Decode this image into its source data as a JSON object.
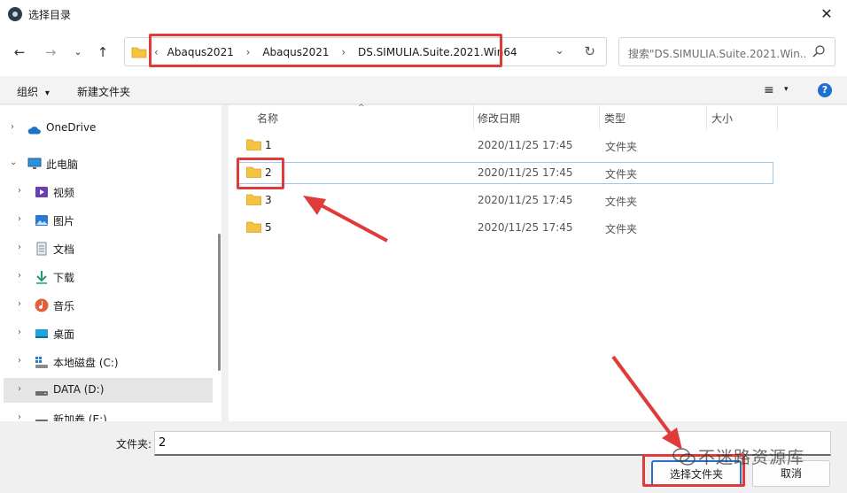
{
  "window": {
    "title": "选择目录",
    "close_glyph": "✕"
  },
  "nav": {
    "back_icon": "←",
    "forward_icon": "→",
    "recent_icon": "⌄",
    "up_icon": "↑",
    "breadcrumbs": [
      "Abaqus2021",
      "Abaqus2021",
      "DS.SIMULIA.Suite.2021.Win64"
    ],
    "overflow": "‹",
    "separator": "›",
    "dropdown_icon": "⌄",
    "refresh_icon": "↻",
    "search_placeholder": "搜索\"DS.SIMULIA.Suite.2021.Win..."
  },
  "toolbar": {
    "organize_label": "组织",
    "organize_caret": "▾",
    "new_folder_label": "新建文件夹",
    "view_icon": "≡",
    "view_caret": "▾",
    "help_label": "?"
  },
  "sidebar": {
    "items": [
      {
        "label": "OneDrive",
        "chev": "›",
        "icon": "cloud-icon"
      },
      {
        "label": "此电脑",
        "chev": "⌄",
        "icon": "computer-icon"
      },
      {
        "label": "视频",
        "chev": "›",
        "icon": "video-icon"
      },
      {
        "label": "图片",
        "chev": "›",
        "icon": "picture-icon"
      },
      {
        "label": "文档",
        "chev": "›",
        "icon": "document-icon"
      },
      {
        "label": "下载",
        "chev": "›",
        "icon": "download-icon"
      },
      {
        "label": "音乐",
        "chev": "›",
        "icon": "music-icon"
      },
      {
        "label": "桌面",
        "chev": "›",
        "icon": "desktop-icon"
      },
      {
        "label": "本地磁盘 (C:)",
        "chev": "›",
        "icon": "drive-c-icon"
      },
      {
        "label": "DATA (D:)",
        "chev": "›",
        "icon": "drive-d-icon",
        "selected": true
      },
      {
        "label": "新加卷 (E:)",
        "chev": "›",
        "icon": "drive-e-icon"
      }
    ]
  },
  "list": {
    "headers": {
      "name": "名称",
      "modified": "修改日期",
      "type": "类型",
      "size": "大小"
    },
    "sort_caret": "^",
    "rows": [
      {
        "name": "1",
        "modified": "2020/11/25 17:45",
        "type": "文件夹"
      },
      {
        "name": "2",
        "modified": "2020/11/25 17:45",
        "type": "文件夹",
        "selected": true
      },
      {
        "name": "3",
        "modified": "2020/11/25 17:45",
        "type": "文件夹"
      },
      {
        "name": "5",
        "modified": "2020/11/25 17:45",
        "type": "文件夹"
      }
    ]
  },
  "bottom": {
    "folder_label": "文件夹:",
    "folder_value": "2",
    "select_button": "选择文件夹",
    "cancel_button": "取消"
  },
  "watermark": {
    "text": "不迷路资源库"
  },
  "colors": {
    "highlight": "#e03a3a",
    "folder": "#f5c342",
    "accent": "#2b6fc9"
  }
}
